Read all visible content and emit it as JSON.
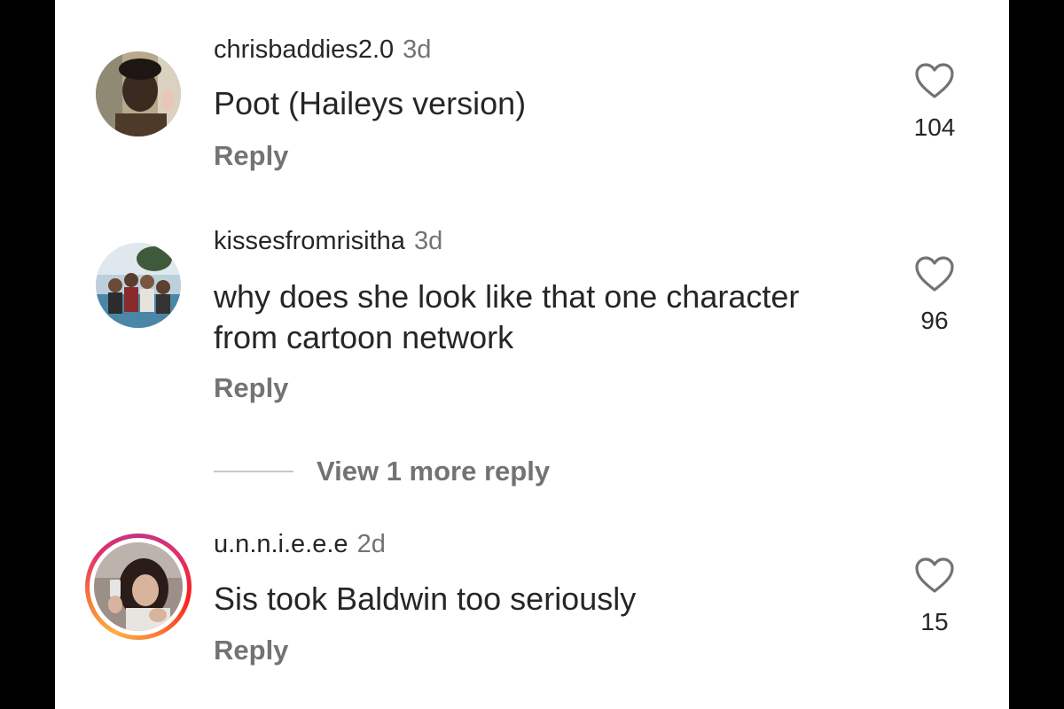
{
  "comments": [
    {
      "username": "chrisbaddies2.0",
      "time": "3d",
      "text": "Poot (Haileys version)",
      "reply_label": "Reply",
      "likes": "104",
      "avatar_ring": false
    },
    {
      "username": "kissesfromrisitha",
      "time": "3d",
      "text": "why does she look like that one character from cartoon network",
      "reply_label": "Reply",
      "likes": "96",
      "avatar_ring": false
    },
    {
      "username": "u.n.n.i.e.e.e",
      "time": "2d",
      "text": "Sis took Baldwin too seriously",
      "reply_label": "Reply",
      "likes": "15",
      "avatar_ring": true
    }
  ],
  "view_more_replies": "View 1 more reply",
  "icons": {
    "like": "heart-outline-icon"
  },
  "colors": {
    "text_primary": "#262626",
    "text_secondary": "#737373",
    "background": "#ffffff",
    "frame": "#000000"
  }
}
